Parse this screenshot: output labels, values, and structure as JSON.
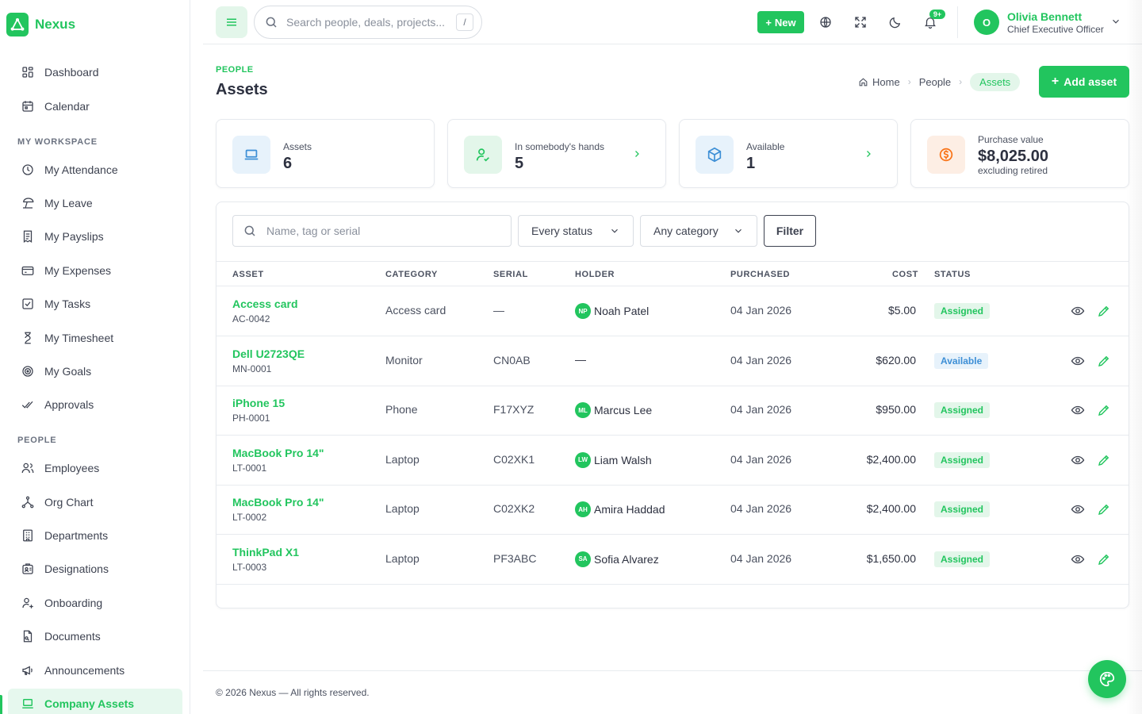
{
  "brand": {
    "name": "Nexus"
  },
  "sidebar": {
    "top_items": [
      {
        "label": "Dashboard",
        "icon": "dashboard-icon"
      },
      {
        "label": "Calendar",
        "icon": "calendar-icon"
      }
    ],
    "workspace_heading": "MY WORKSPACE",
    "workspace_items": [
      {
        "label": "My Attendance",
        "icon": "clock-icon"
      },
      {
        "label": "My Leave",
        "icon": "beach-icon"
      },
      {
        "label": "My Payslips",
        "icon": "receipt-icon"
      },
      {
        "label": "My Expenses",
        "icon": "card-icon"
      },
      {
        "label": "My Tasks",
        "icon": "checkbox-icon"
      },
      {
        "label": "My Timesheet",
        "icon": "hourglass-icon"
      },
      {
        "label": "My Goals",
        "icon": "target-icon"
      },
      {
        "label": "Approvals",
        "icon": "double-check-icon"
      }
    ],
    "people_heading": "PEOPLE",
    "people_items": [
      {
        "label": "Employees",
        "icon": "users-icon"
      },
      {
        "label": "Org Chart",
        "icon": "org-chart-icon"
      },
      {
        "label": "Departments",
        "icon": "building-icon"
      },
      {
        "label": "Designations",
        "icon": "id-badge-icon"
      },
      {
        "label": "Onboarding",
        "icon": "user-plus-icon"
      },
      {
        "label": "Documents",
        "icon": "document-icon"
      },
      {
        "label": "Announcements",
        "icon": "megaphone-icon"
      },
      {
        "label": "Company Assets",
        "icon": "laptop-icon",
        "active": true
      }
    ]
  },
  "topbar": {
    "search_placeholder": "Search people, deals, projects...",
    "search_shortcut": "/",
    "new_label": "New",
    "notification_badge": "9+",
    "user": {
      "initial": "O",
      "name": "Olivia Bennett",
      "role": "Chief Executive Officer"
    }
  },
  "page": {
    "eyebrow": "PEOPLE",
    "title": "Assets",
    "breadcrumb": [
      "Home",
      "People",
      "Assets"
    ],
    "add_button": "Add asset"
  },
  "stats": [
    {
      "label": "Assets",
      "value": "6",
      "icon": "laptop-icon",
      "color": "#3d8fd6",
      "bg": "#e7f2fb"
    },
    {
      "label": "In somebody's hands",
      "value": "5",
      "icon": "user-check-icon",
      "color": "#22c55e",
      "bg": "#e3f6ea"
    },
    {
      "label": "Available",
      "value": "1",
      "icon": "box-icon",
      "color": "#3d8fd6",
      "bg": "#e7f2fb"
    },
    {
      "label": "Purchase value",
      "value": "$8,025.00",
      "sub": "excluding retired",
      "icon": "dollar-coin-icon",
      "color": "#f97316",
      "bg": "#fdeee4"
    }
  ],
  "filters": {
    "search_placeholder": "Name, tag or serial",
    "status_select": "Every status",
    "category_select": "Any category",
    "filter_button": "Filter"
  },
  "table": {
    "headers": [
      "ASSET",
      "CATEGORY",
      "SERIAL",
      "HOLDER",
      "PURCHASED",
      "COST",
      "STATUS"
    ],
    "rows": [
      {
        "name": "Access card",
        "tag": "AC-0042",
        "category": "Access card",
        "serial": "—",
        "holder_initials": "NP",
        "holder": "Noah Patel",
        "purchased": "04 Jan 2026",
        "cost": "$5.00",
        "status": "Assigned"
      },
      {
        "name": "Dell U2723QE",
        "tag": "MN-0001",
        "category": "Monitor",
        "serial": "CN0AB",
        "holder_initials": "",
        "holder": "—",
        "purchased": "04 Jan 2026",
        "cost": "$620.00",
        "status": "Available"
      },
      {
        "name": "iPhone 15",
        "tag": "PH-0001",
        "category": "Phone",
        "serial": "F17XYZ",
        "holder_initials": "ML",
        "holder": "Marcus Lee",
        "purchased": "04 Jan 2026",
        "cost": "$950.00",
        "status": "Assigned"
      },
      {
        "name": "MacBook Pro 14\"",
        "tag": "LT-0001",
        "category": "Laptop",
        "serial": "C02XK1",
        "holder_initials": "LW",
        "holder": "Liam Walsh",
        "purchased": "04 Jan 2026",
        "cost": "$2,400.00",
        "status": "Assigned"
      },
      {
        "name": "MacBook Pro 14\"",
        "tag": "LT-0002",
        "category": "Laptop",
        "serial": "C02XK2",
        "holder_initials": "AH",
        "holder": "Amira Haddad",
        "purchased": "04 Jan 2026",
        "cost": "$2,400.00",
        "status": "Assigned"
      },
      {
        "name": "ThinkPad X1",
        "tag": "LT-0003",
        "category": "Laptop",
        "serial": "PF3ABC",
        "holder_initials": "SA",
        "holder": "Sofia Alvarez",
        "purchased": "04 Jan 2026",
        "cost": "$1,650.00",
        "status": "Assigned"
      }
    ]
  },
  "footer": {
    "text": "© 2026 Nexus — All rights reserved."
  },
  "colors": {
    "accent": "#22c55e",
    "available": "#3d8fd6"
  }
}
